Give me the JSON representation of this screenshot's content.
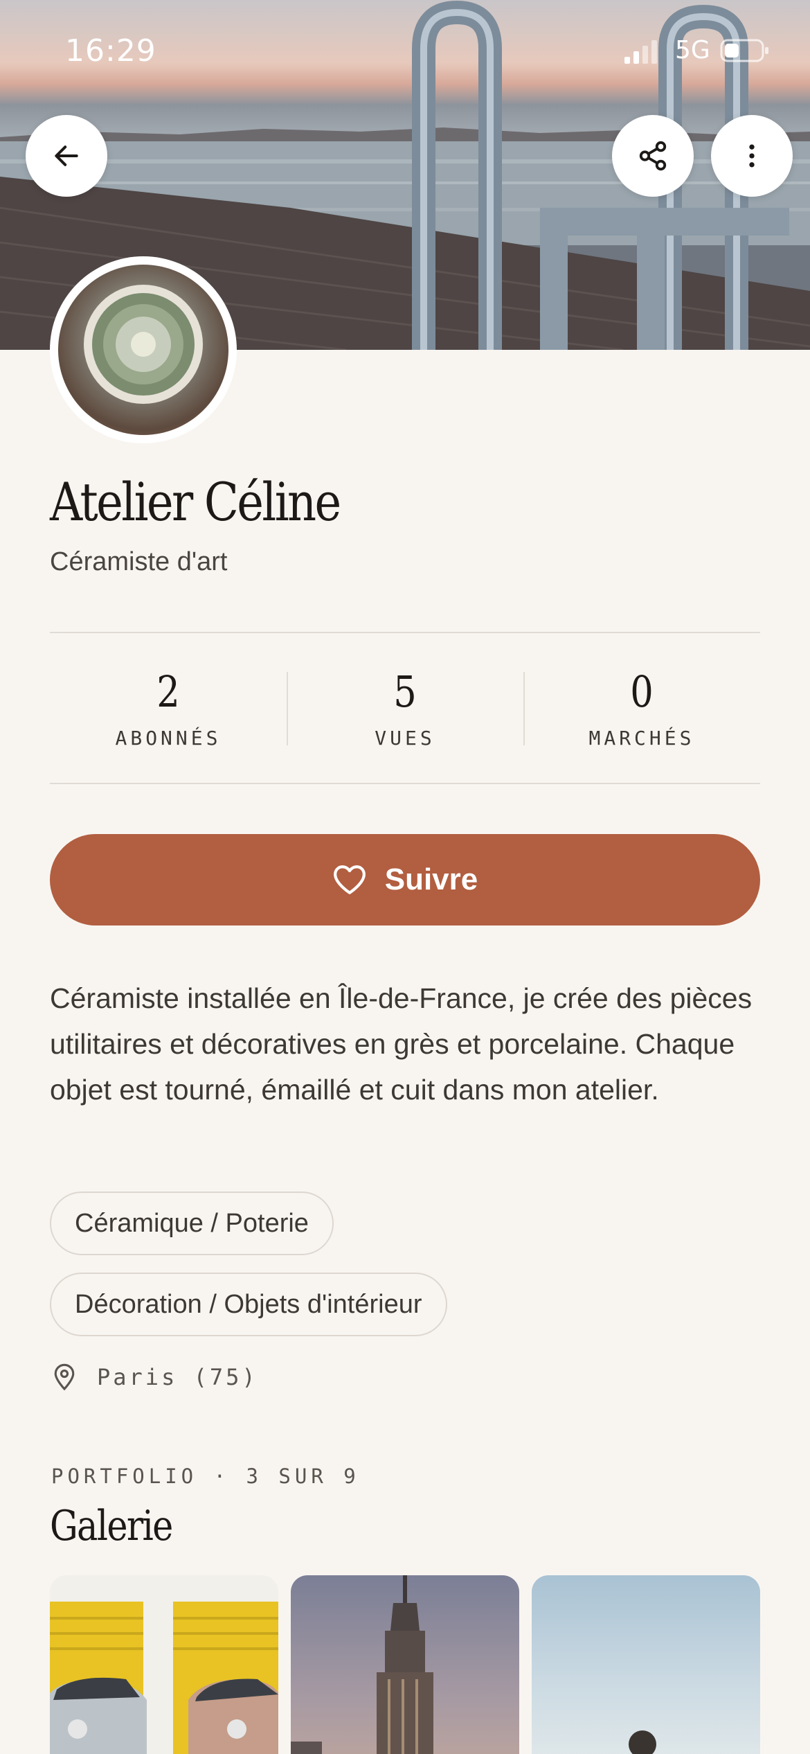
{
  "status_bar": {
    "time": "16:29",
    "network": "5G"
  },
  "profile": {
    "name": "Atelier Céline",
    "role": "Céramiste d'art"
  },
  "stats": [
    {
      "value": "2",
      "label": "ABONNÉS"
    },
    {
      "value": "5",
      "label": "VUES"
    },
    {
      "value": "0",
      "label": "MARCHÉS"
    }
  ],
  "follow_button": {
    "label": "Suivre"
  },
  "bio": "Céramiste installée en Île-de-France, je crée des pièces utilitaires et décoratives en grès et porcelaine. Chaque objet est tourné, émaillé et cuit dans mon atelier.",
  "tags": [
    "Céramique / Poterie",
    "Décoration / Objets d'intérieur"
  ],
  "location": "Paris (75)",
  "portfolio": {
    "eyebrow": "PORTFOLIO · 3 SUR 9",
    "title": "Galerie"
  },
  "icons": {
    "back": "arrow-left-icon",
    "share": "share-icon",
    "more": "more-vertical-icon",
    "follow": "heart-icon",
    "location": "map-pin-icon"
  },
  "colors": {
    "background": "#f8f5f1",
    "accent": "#b25e40",
    "text": "#1c1917"
  }
}
